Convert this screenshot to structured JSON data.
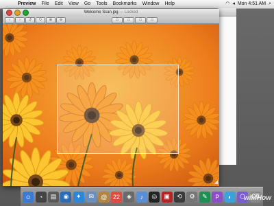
{
  "menubar": {
    "apple_icon": "apple-icon",
    "items": [
      "Preview",
      "File",
      "Edit",
      "View",
      "Go",
      "Tools",
      "Bookmarks",
      "Window",
      "Help"
    ],
    "clock": "Mon 4:51 AM"
  },
  "window": {
    "title": "Welcome Scan.jpg",
    "title_suffix": " — Locked",
    "toolbar_buttons": [
      "‹",
      "›",
      "↺",
      "↻",
      "⊕",
      "⊖"
    ],
    "view_buttons": [
      "▭",
      "▭",
      "▭",
      "▭"
    ]
  },
  "colors": {
    "petal_orange": "#f7941d",
    "petal_yellow": "#fdc52f",
    "flower_center": "#5a3a1a",
    "background_orange": "#e8771b"
  },
  "dock": {
    "apps": [
      {
        "icon": "finder-icon",
        "color": "#3a7bd5",
        "glyph": "☺"
      },
      {
        "icon": "dashboard-icon",
        "color": "#444",
        "glyph": "◔"
      },
      {
        "icon": "app-icon",
        "color": "#5a5a5a",
        "glyph": "▤"
      },
      {
        "icon": "app-icon",
        "color": "#2d6cb5",
        "glyph": "◉"
      },
      {
        "icon": "safari-icon",
        "color": "#2b88d8",
        "glyph": "✦"
      },
      {
        "icon": "mail-icon",
        "color": "#6a8fbf",
        "glyph": "✉"
      },
      {
        "icon": "address-book-icon",
        "color": "#b3853f",
        "glyph": "@"
      },
      {
        "icon": "ical-icon",
        "color": "#e14b3b",
        "glyph": "22"
      },
      {
        "icon": "photo-icon",
        "color": "#6a6a6a",
        "glyph": "◈"
      },
      {
        "icon": "itunes-icon",
        "color": "#5a8ed6",
        "glyph": "♪"
      },
      {
        "icon": "dvd-icon",
        "color": "#222",
        "glyph": "◎"
      },
      {
        "icon": "photo-booth-icon",
        "color": "#b22",
        "glyph": "▣"
      },
      {
        "icon": "time-machine-icon",
        "color": "#3b3b3b",
        "glyph": "⟲"
      },
      {
        "icon": "system-preferences-icon",
        "color": "#777",
        "glyph": "⚙"
      },
      {
        "icon": "app-icon",
        "color": "#1d8f53",
        "glyph": "✎"
      },
      {
        "icon": "app-icon",
        "color": "#8b4fc7",
        "glyph": "P"
      },
      {
        "icon": "app-icon",
        "color": "#3aa2dc",
        "glyph": "◐"
      },
      {
        "icon": "app-icon",
        "color": "#7a5bd6",
        "glyph": "⬡"
      },
      {
        "icon": "trash-icon",
        "color": "#888",
        "glyph": "⌫"
      }
    ]
  },
  "watermark": "wikiHow"
}
